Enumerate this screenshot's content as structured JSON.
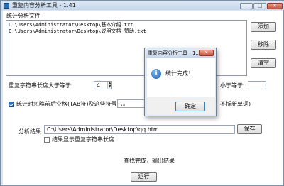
{
  "window": {
    "title": "重复内容分析工具 - 1.41",
    "minimize": "–",
    "maximize": "□",
    "close": "✕"
  },
  "files_group": {
    "label": "统计分析文件",
    "files": [
      "C:\\Users\\Administrator\\Desktop\\基本介绍.txt",
      "C:\\Users\\Administrator\\Desktop\\说明文档-赞助.txt"
    ],
    "add_label": "添加",
    "remove_label": "移除",
    "clear_label": "清空"
  },
  "options": {
    "min_length_label": "重复字符串长度大于等于:",
    "min_length_value": "4",
    "right_label_partial": "小于等于:",
    "right_value": "",
    "ignore_checked": true,
    "ignore_label": "统计时忽略前后空格(TAB符)及这些符号:",
    "ignore_symbols": "，。",
    "right_note_partial": "不拆新单词)"
  },
  "result": {
    "label": "分析结果:",
    "path": "C:\\Users\\Administrator\\Desktop\\qq.htm",
    "save_label": "保存",
    "show_length_checked": false,
    "show_length_label": "结果显示重复字符串长度",
    "status": "查找完成，输出结果",
    "run_label": "运行"
  },
  "dialog": {
    "title": "重复内容分析工具 - 1...",
    "close": "✕",
    "icon_glyph": "i",
    "message": "统计完成！",
    "ok_label": "确定"
  },
  "colors": {
    "window_border": "#7a8ea6",
    "titlebar": "#c5d6ea",
    "close_button": "#c9503a"
  }
}
